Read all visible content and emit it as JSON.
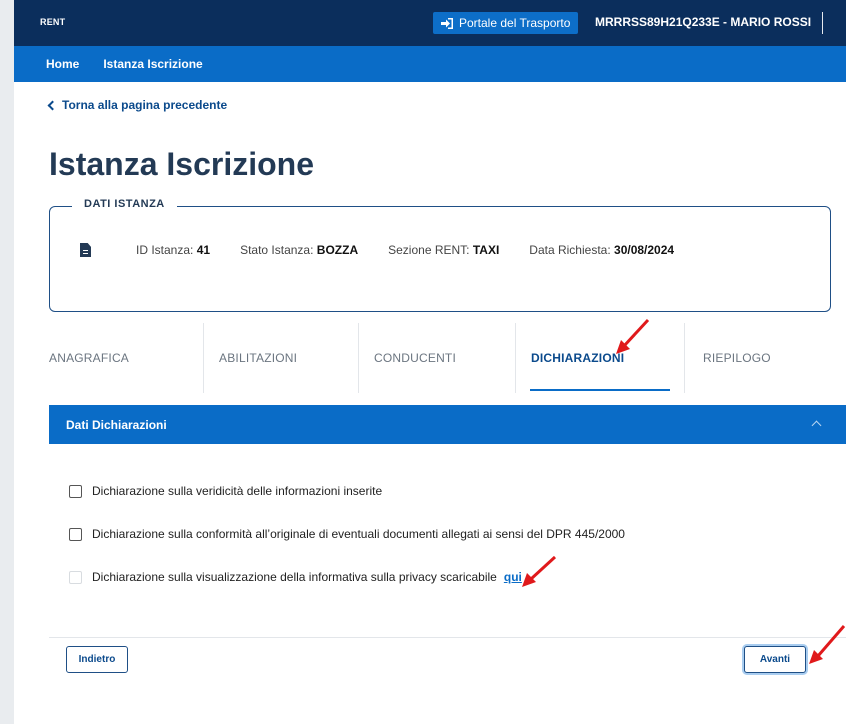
{
  "header": {
    "brand": "RENT",
    "portal_button": "Portale del Trasporto",
    "user": "MRRRSS89H21Q233E - MARIO ROSSI"
  },
  "nav": {
    "items": [
      {
        "label": "Home"
      },
      {
        "label": "Istanza Iscrizione"
      }
    ]
  },
  "back_link": "Torna alla pagina precedente",
  "page_title": "Istanza Iscrizione",
  "dati_istanza": {
    "legend": "DATI ISTANZA",
    "fields": [
      {
        "label": "ID Istanza:",
        "value": "41"
      },
      {
        "label": "Stato Istanza:",
        "value": "BOZZA"
      },
      {
        "label": "Sezione RENT:",
        "value": "TAXI"
      },
      {
        "label": "Data Richiesta:",
        "value": "30/08/2024"
      }
    ]
  },
  "tabs": [
    {
      "label": "ANAGRAFICA"
    },
    {
      "label": "ABILITAZIONI"
    },
    {
      "label": "CONDUCENTI"
    },
    {
      "label": "DICHIARAZIONI"
    },
    {
      "label": "RIEPILOGO"
    }
  ],
  "section": {
    "title": "Dati Dichiarazioni"
  },
  "declarations": [
    {
      "label": "Dichiarazione sulla veridicità delle informazioni inserite"
    },
    {
      "label": "Dichiarazione sulla conformità all’originale di eventuali documenti allegati ai sensi del DPR 445/2000"
    },
    {
      "label": "Dichiarazione sulla visualizzazione della informativa sulla privacy scaricabile",
      "link": "qui"
    }
  ],
  "buttons": {
    "back": "Indietro",
    "next": "Avanti"
  },
  "colors": {
    "topbar": "#0b2e5c",
    "primary": "#0a6cc7",
    "annotation": "#e0191b"
  }
}
